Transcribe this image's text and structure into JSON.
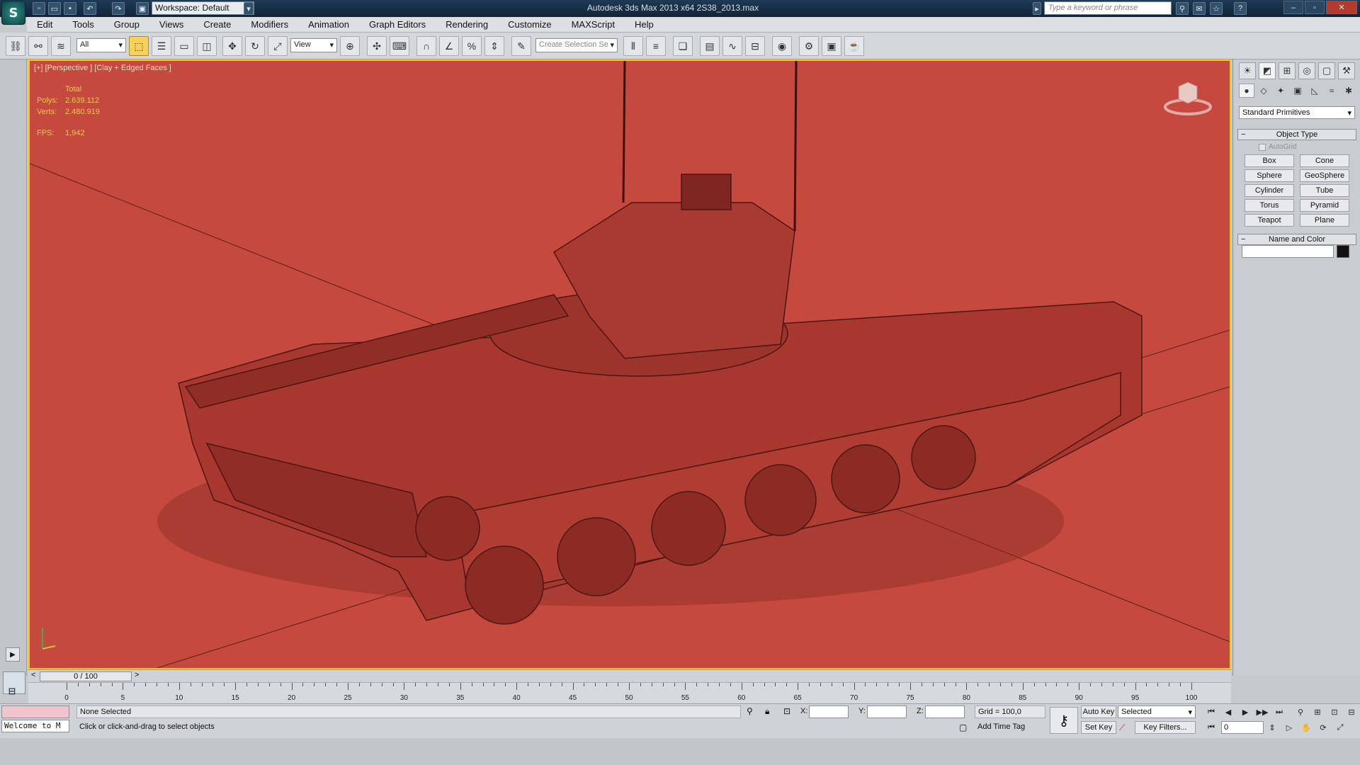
{
  "titlebar": {
    "workspace": "Workspace: Default",
    "title": "Autodesk 3ds Max  2013 x64     2S38_2013.max",
    "search_placeholder": "Type a keyword or phrase"
  },
  "menu": [
    "Edit",
    "Tools",
    "Group",
    "Views",
    "Create",
    "Modifiers",
    "Animation",
    "Graph Editors",
    "Rendering",
    "Customize",
    "MAXScript",
    "Help"
  ],
  "toolbar": {
    "filter": "All",
    "ref_coord": "View",
    "selection_set_placeholder": "Create Selection Se"
  },
  "viewport": {
    "label": "[+] [Perspective ] [Clay + Edged Faces ]",
    "stats": {
      "total_label": "Total",
      "polys_label": "Polys:",
      "polys": "2.639.112",
      "verts_label": "Verts:",
      "verts": "2.480.919",
      "fps_label": "FPS:",
      "fps": "1,942"
    },
    "background_color": "#c5493f",
    "model_color": "#a8372f"
  },
  "command_panel": {
    "category": "Standard Primitives",
    "object_type_title": "Object Type",
    "autogrid": "AutoGrid",
    "primitives": [
      "Box",
      "Cone",
      "Sphere",
      "GeoSphere",
      "Cylinder",
      "Tube",
      "Torus",
      "Pyramid",
      "Teapot",
      "Plane"
    ],
    "name_color_title": "Name and Color"
  },
  "timeline": {
    "position": "0 / 100",
    "ticks": [
      "0",
      "5",
      "10",
      "15",
      "20",
      "25",
      "30",
      "35",
      "40",
      "45",
      "50",
      "55",
      "60",
      "65",
      "70",
      "75",
      "80",
      "85",
      "90",
      "95",
      "100"
    ]
  },
  "status": {
    "listener": "Welcome to M",
    "selection": "None Selected",
    "prompt": "Click or click-and-drag to select objects",
    "x_label": "X:",
    "y_label": "Y:",
    "z_label": "Z:",
    "grid": "Grid = 100,0",
    "add_time_tag": "Add Time Tag",
    "auto_key": "Auto Key",
    "set_key": "Set Key",
    "key_mode": "Selected",
    "key_filters": "Key Filters...",
    "frame": "0"
  }
}
